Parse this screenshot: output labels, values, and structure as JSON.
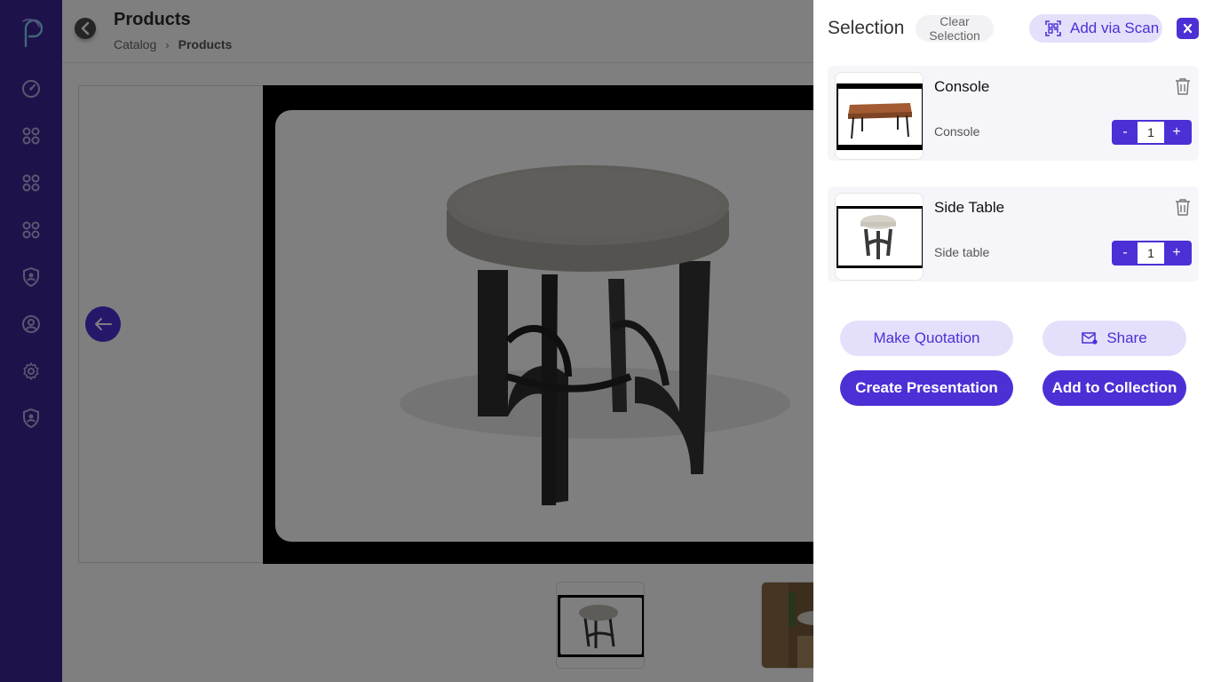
{
  "header": {
    "title": "Products",
    "breadcrumb": {
      "root": "Catalog",
      "separator": "›",
      "current": "Products"
    }
  },
  "sidebar": {
    "items": [
      {
        "icon": "dashboard-icon"
      },
      {
        "icon": "grid-icon"
      },
      {
        "icon": "grid-icon"
      },
      {
        "icon": "grid-icon"
      },
      {
        "icon": "shield-user-icon"
      },
      {
        "icon": "user-circle-icon"
      },
      {
        "icon": "gear-icon"
      },
      {
        "icon": "shield-user-icon"
      }
    ]
  },
  "selection": {
    "title": "Selection",
    "clear_label": "Clear Selection",
    "scan_label": "Add via Scan",
    "close_label": "×",
    "items": [
      {
        "name": "Console",
        "subtitle": "Console",
        "quantity": "1"
      },
      {
        "name": "Side Table",
        "subtitle": "Side table",
        "quantity": "1"
      }
    ],
    "stepper": {
      "minus": "-",
      "plus": "+"
    },
    "actions": {
      "make_quotation": "Make Quotation",
      "share": "Share",
      "create_presentation": "Create Presentation",
      "add_to_collection": "Add to Collection"
    }
  },
  "colors": {
    "sidebar_bg": "#3d2596",
    "accent": "#4d2fd6",
    "accent_light": "#e4e0fb"
  }
}
